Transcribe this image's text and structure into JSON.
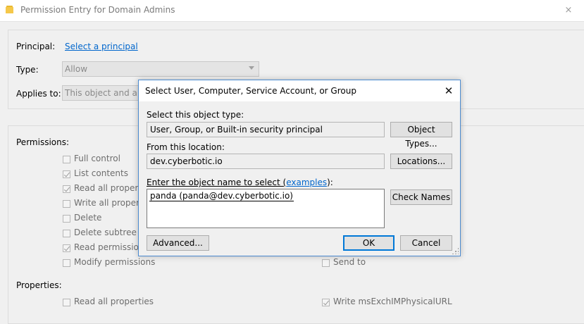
{
  "window": {
    "title": "Permission Entry for Domain Admins",
    "close_glyph": "×"
  },
  "principal": {
    "label": "Principal:",
    "link": "Select a principal"
  },
  "type": {
    "label": "Type:",
    "value": "Allow"
  },
  "applies_to": {
    "label": "Applies to:",
    "value": "This object and all d"
  },
  "permissions": {
    "label": "Permissions:",
    "left_items": [
      {
        "label": "Full control",
        "checked": false
      },
      {
        "label": "List contents",
        "checked": true
      },
      {
        "label": "Read all properties",
        "checked": true
      },
      {
        "label": "Write all properties",
        "checked": false
      },
      {
        "label": "Delete",
        "checked": false
      },
      {
        "label": "Delete subtree",
        "checked": false
      },
      {
        "label": "Read permissions",
        "checked": true
      },
      {
        "label": "Modify permissions",
        "checked": false
      }
    ],
    "right_items": [
      {
        "label": "Send to",
        "checked": false
      }
    ]
  },
  "properties": {
    "label": "Properties:",
    "left_items": [
      {
        "label": "Read all properties",
        "checked": false
      }
    ],
    "right_items": [
      {
        "label": "Write msExchIMPhysicalURL",
        "checked": true
      }
    ]
  },
  "dialog": {
    "title": "Select User, Computer, Service Account, or Group",
    "close_glyph": "✕",
    "object_type_label": "Select this object type:",
    "object_type_value": "User, Group, or Built-in security principal",
    "object_types_button": "Object Types...",
    "location_label": "From this location:",
    "location_value": "dev.cyberbotic.io",
    "locations_button": "Locations...",
    "enter_label_prefix": "Enter the object name to select (",
    "enter_label_link": "examples",
    "enter_label_suffix": "):",
    "object_name_value": "panda (panda@dev.cyberbotic.io)",
    "check_names_button": "Check Names",
    "advanced_button": "Advanced...",
    "ok_button": "OK",
    "cancel_button": "Cancel"
  }
}
